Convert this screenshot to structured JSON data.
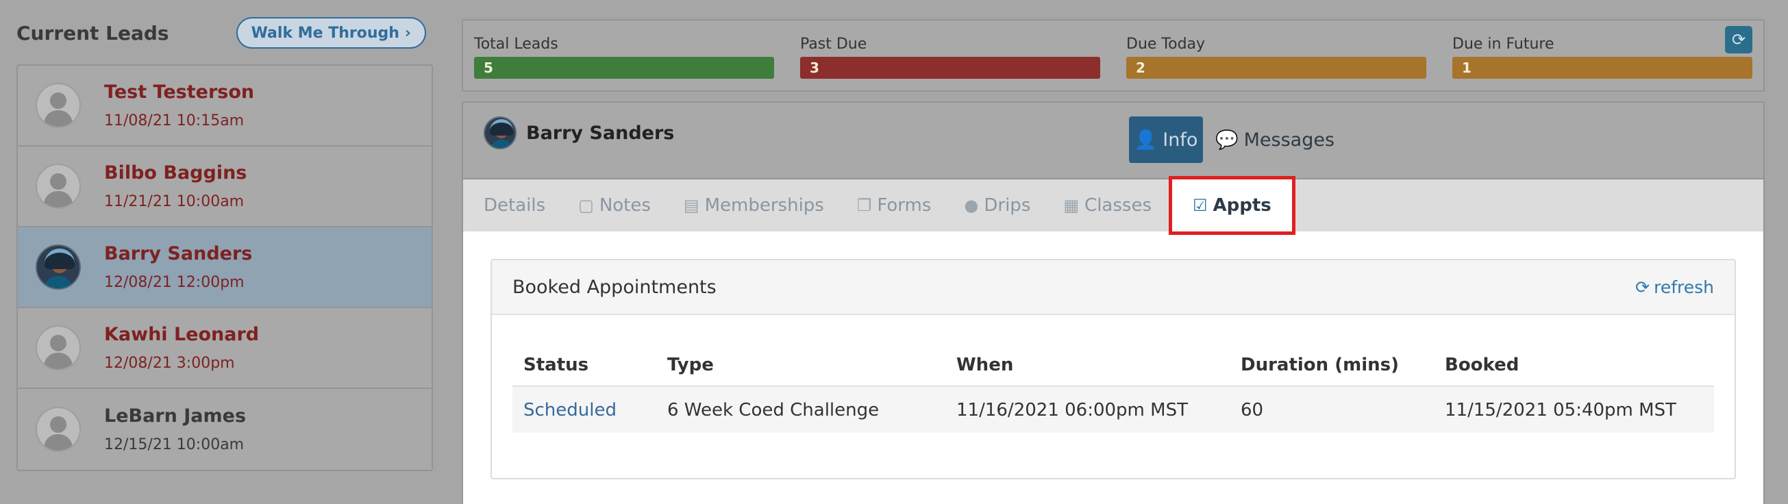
{
  "leads_panel": {
    "title": "Current Leads",
    "walk_button": "Walk Me Through",
    "items": [
      {
        "name": "Test Testerson",
        "date": "11/08/21 10:15am"
      },
      {
        "name": "Bilbo Baggins",
        "date": "11/21/21 10:00am"
      },
      {
        "name": "Barry Sanders",
        "date": "12/08/21 12:00pm"
      },
      {
        "name": "Kawhi Leonard",
        "date": "12/08/21 3:00pm"
      },
      {
        "name": "LeBarn James",
        "date": "12/15/21 10:00am"
      }
    ]
  },
  "stats": {
    "total": {
      "label": "Total Leads",
      "value": "5",
      "color": "#3f7d3c"
    },
    "past_due": {
      "label": "Past Due",
      "value": "3",
      "color": "#8c2e2c"
    },
    "due_today": {
      "label": "Due Today",
      "value": "2",
      "color": "#a7742b"
    },
    "future": {
      "label": "Due in Future",
      "value": "1",
      "color": "#a7742b"
    }
  },
  "detail": {
    "person_name": "Barry Sanders",
    "info_button": "Info",
    "messages_link": "Messages",
    "tabs": [
      "Details",
      "Notes",
      "Memberships",
      "Forms",
      "Drips",
      "Classes",
      "Appts"
    ],
    "active_tab": "Appts"
  },
  "appointments": {
    "title": "Booked Appointments",
    "refresh_label": "refresh",
    "columns": [
      "Status",
      "Type",
      "When",
      "Duration (mins)",
      "Booked"
    ],
    "rows": [
      {
        "status": "Scheduled",
        "type": "6 Week Coed Challenge",
        "when": "11/16/2021 06:00pm MST",
        "duration": "60",
        "booked": "11/15/2021 05:40pm MST"
      }
    ]
  }
}
